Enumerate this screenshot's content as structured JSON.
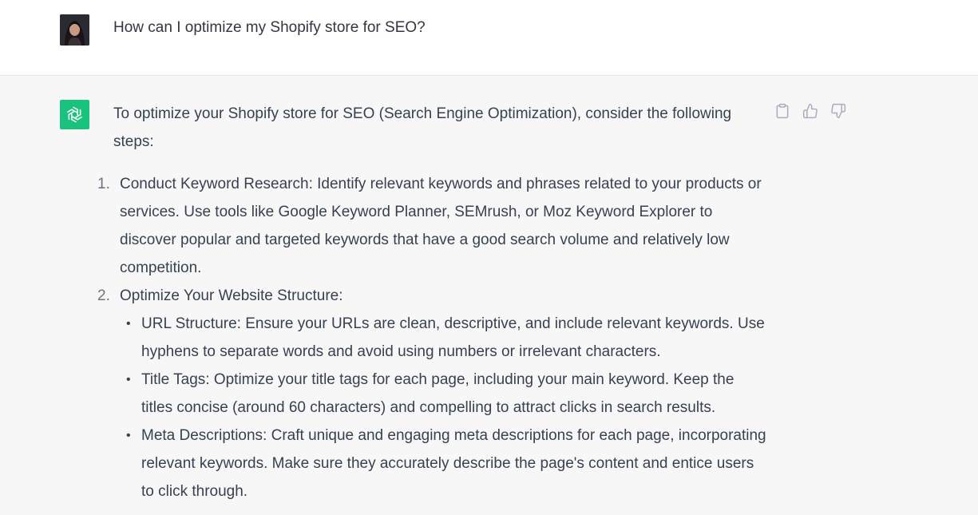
{
  "user_message": {
    "text": "How can I optimize my Shopify store for SEO?"
  },
  "assistant_message": {
    "intro": "To optimize your Shopify store for SEO (Search Engine Optimization), consider the following steps:",
    "steps": [
      {
        "number": "1.",
        "text": "Conduct Keyword Research: Identify relevant keywords and phrases related to your products or services. Use tools like Google Keyword Planner, SEMrush, or Moz Keyword Explorer to discover popular and targeted keywords that have a good search volume and relatively low competition."
      },
      {
        "number": "2.",
        "text": "Optimize Your Website Structure:",
        "sub": [
          "URL Structure: Ensure your URLs are clean, descriptive, and include relevant keywords. Use hyphens to separate words and avoid using numbers or irrelevant characters.",
          "Title Tags: Optimize your title tags for each page, including your main keyword. Keep the titles concise (around 60 characters) and compelling to attract clicks in search results.",
          "Meta Descriptions: Craft unique and engaging meta descriptions for each page, incorporating relevant keywords. Make sure they accurately describe the page's content and entice users to click through."
        ]
      }
    ]
  },
  "actions": {
    "icons": [
      "clipboard-icon",
      "thumbs-up-icon",
      "thumbs-down-icon"
    ]
  },
  "colors": {
    "assistant_bg": "#f7f7f8",
    "bot_avatar_bg": "#19c37d",
    "text": "#374151"
  }
}
